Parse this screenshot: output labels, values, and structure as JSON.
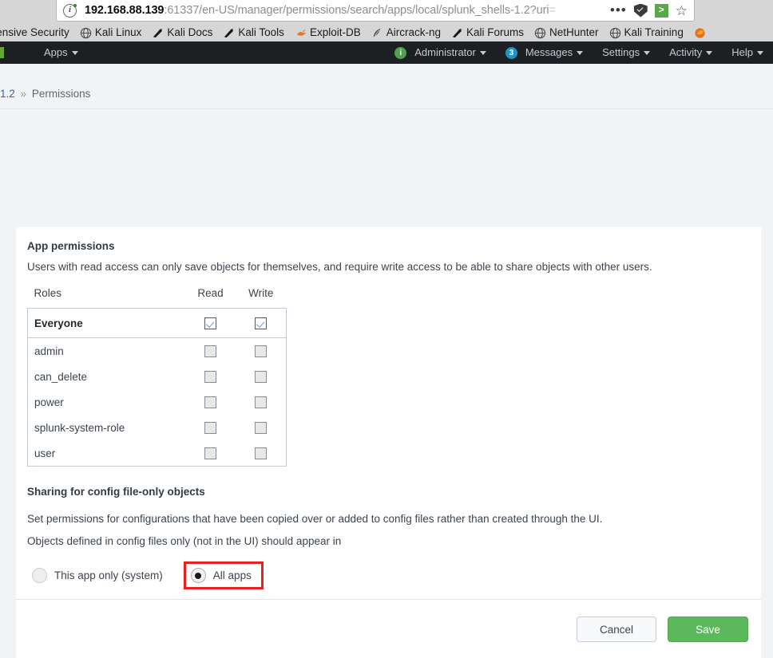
{
  "browser": {
    "url_host": "192.168.88.139",
    "url_rest": ":61337/en-US/manager/permissions/search/apps/local/splunk_shells-1.2?uri",
    "url_fade": "=",
    "icons": {
      "info": "info-icon",
      "dots": "•••",
      "star": "☆",
      "container_tab": ">"
    },
    "bookmarks": [
      {
        "label": "ffensive Security",
        "icon": "globe-icon"
      },
      {
        "label": "Kali Linux",
        "icon": "globe-icon"
      },
      {
        "label": "Kali Docs",
        "icon": "dragon-icon"
      },
      {
        "label": "Kali Tools",
        "icon": "dragon-icon"
      },
      {
        "label": "Exploit-DB",
        "icon": "exploitdb-icon"
      },
      {
        "label": "Aircrack-ng",
        "icon": "aircrack-icon"
      },
      {
        "label": "Kali Forums",
        "icon": "dragon-icon"
      },
      {
        "label": "NetHunter",
        "icon": "globe-icon"
      },
      {
        "label": "Kali Training",
        "icon": "globe-icon"
      }
    ]
  },
  "splunk_nav": {
    "apps_label": "Apps",
    "user_label": "Administrator",
    "user_badge": "i",
    "messages_label": "Messages",
    "messages_badge": "3",
    "settings_label": "Settings",
    "activity_label": "Activity",
    "help_label": "Help"
  },
  "breadcrumb": {
    "link": "1.2",
    "separator": "»",
    "current": "Permissions"
  },
  "panel": {
    "title": "App permissions",
    "description": "Users with read access can only save objects for themselves, and require write access to be able to share objects with other users.",
    "table": {
      "headers": [
        "Roles",
        "Read",
        "Write"
      ],
      "rows": [
        {
          "role": "Everyone",
          "read": true,
          "write": true,
          "emphasis": true
        },
        {
          "role": "admin",
          "read": false,
          "write": false,
          "emphasis": false
        },
        {
          "role": "can_delete",
          "read": false,
          "write": false,
          "emphasis": false
        },
        {
          "role": "power",
          "read": false,
          "write": false,
          "emphasis": false
        },
        {
          "role": "splunk-system-role",
          "read": false,
          "write": false,
          "emphasis": false
        },
        {
          "role": "user",
          "read": false,
          "write": false,
          "emphasis": false
        }
      ]
    },
    "sharing": {
      "title": "Sharing for config file-only objects",
      "line1": "Set permissions for configurations that have been copied over or added to config files rather than created through the UI.",
      "line2": "Objects defined in config files only (not in the UI) should appear in",
      "options": [
        {
          "label": "This app only (system)",
          "selected": false,
          "highlighted": false
        },
        {
          "label": "All apps",
          "selected": true,
          "highlighted": true
        }
      ]
    },
    "footer": {
      "cancel_label": "Cancel",
      "save_label": "Save"
    }
  },
  "colors": {
    "accent_green": "#5cb85c",
    "highlight_red": "#e8201f",
    "nav_bg": "#1c2022",
    "link_blue": "#3863a0"
  }
}
